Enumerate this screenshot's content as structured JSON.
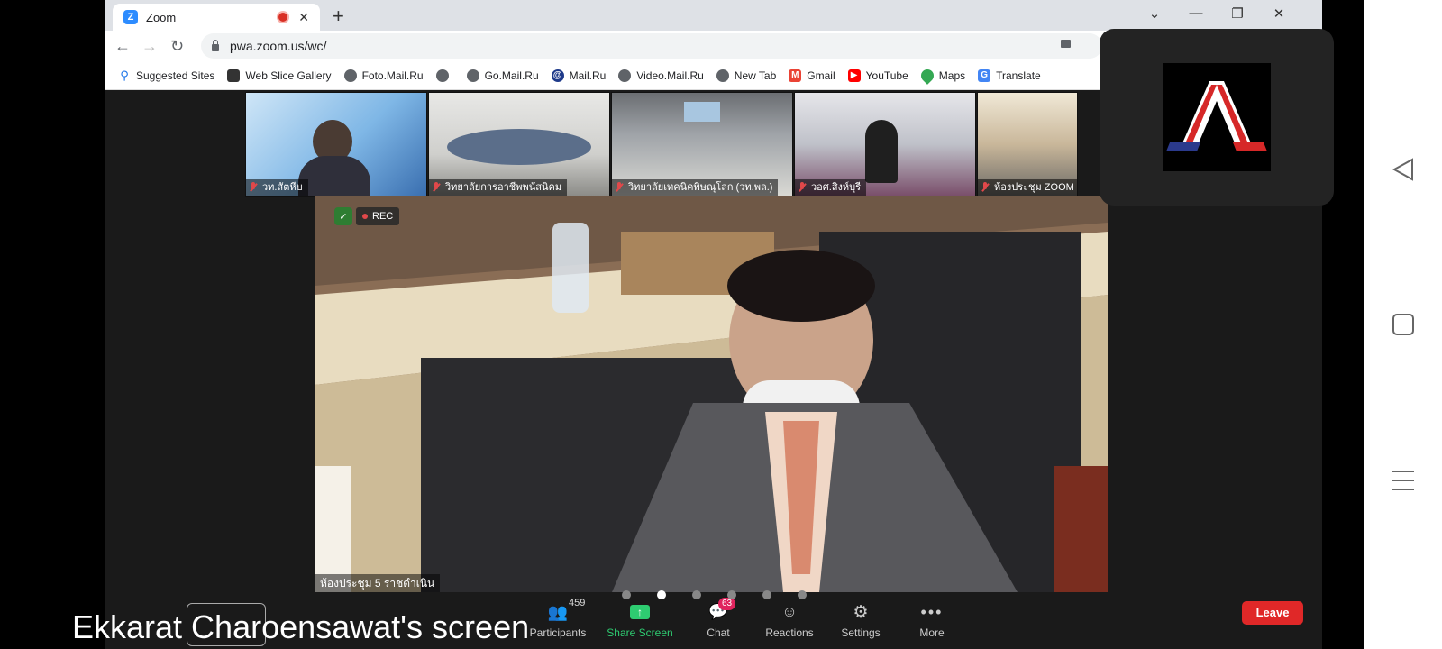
{
  "browser": {
    "tab_title": "Zoom",
    "tab_close": "✕",
    "new_tab": "+",
    "url": "pwa.zoom.us/wc/",
    "window_controls": [
      "⌄",
      "—",
      "❐",
      "✕"
    ],
    "bookmarks": [
      {
        "label": "Suggested Sites",
        "icon": "search-icon"
      },
      {
        "label": "Web Slice Gallery",
        "icon": "web-slice-icon"
      },
      {
        "label": "Foto.Mail.Ru",
        "icon": "globe-icon"
      },
      {
        "label": "",
        "icon": "globe-icon"
      },
      {
        "label": "Go.Mail.Ru",
        "icon": "globe-icon"
      },
      {
        "label": "Mail.Ru",
        "icon": "mailru-icon"
      },
      {
        "label": "Video.Mail.Ru",
        "icon": "globe-icon"
      },
      {
        "label": "New Tab",
        "icon": "globe-icon"
      },
      {
        "label": "Gmail",
        "icon": "gmail-icon"
      },
      {
        "label": "YouTube",
        "icon": "youtube-icon"
      },
      {
        "label": "Maps",
        "icon": "maps-icon"
      },
      {
        "label": "Translate",
        "icon": "translate-icon"
      }
    ]
  },
  "gallery": [
    {
      "label": "วท.สัตหีบ"
    },
    {
      "label": "วิทยาลัยการอาชีพพนัสนิคม"
    },
    {
      "label": "วิทยาลัยเทคนิคพิษณุโลก (วท.พล.)"
    },
    {
      "label": "วอศ.สิงห์บุรี"
    },
    {
      "label": "ห้องประชุม ZOOM"
    }
  ],
  "main_video": {
    "rec_label": "REC",
    "label": "ห้องประชุม 5 ราชดำเนิน"
  },
  "controls": {
    "participants_label": "Participants",
    "participants_count": "459",
    "share_label": "Share Screen",
    "chat_label": "Chat",
    "chat_badge": "63",
    "reactions_label": "Reactions",
    "settings_label": "Settings",
    "more_label": "More",
    "leave_label": "Leave"
  },
  "caption": "Ekkarat Charoensawat's screen",
  "colors": {
    "zoom_blue": "#2d8cff",
    "share_green": "#2ecc71",
    "leave_red": "#e02828",
    "chat_badge": "#e0245e"
  }
}
